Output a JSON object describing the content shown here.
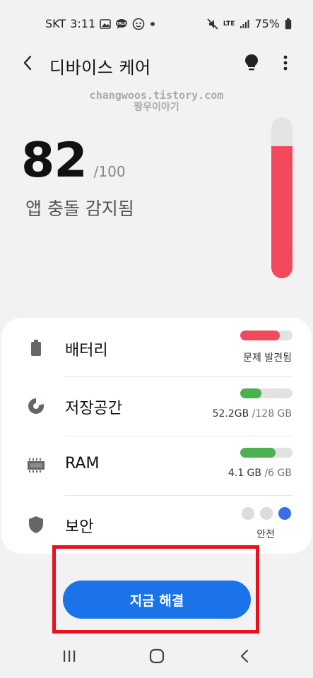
{
  "status_bar": {
    "carrier": "SKT",
    "time": "3:11",
    "network_top": "LTE",
    "battery": "75%",
    "icons": [
      "image-icon",
      "talk-icon",
      "chat-icon",
      "face-icon",
      "dot-icon"
    ],
    "right_icons": [
      "mute-icon",
      "lte-icon",
      "signal-icon",
      "battery-icon"
    ]
  },
  "header": {
    "title": "디바이스 케어",
    "icons": [
      "back-icon",
      "lightbulb-icon",
      "more-vert-icon"
    ]
  },
  "watermark": {
    "line1": "changwoos.tistory.com",
    "line2": "짱우이야기"
  },
  "score": {
    "value": "82",
    "max": "/100",
    "status": "앱 충돌 감지됨",
    "gauge_level": 0.82,
    "gauge_color": "#f24a5c"
  },
  "card": {
    "items": [
      {
        "label": "배터리",
        "icon": "battery-icon",
        "value": "문제 발견됨",
        "value_sub": "",
        "bar_level": 0.75,
        "bar_color": "#f24a5c"
      },
      {
        "label": "저장공간",
        "icon": "pie-chart-icon",
        "value": "52.2GB",
        "value_sub": "/128 GB",
        "bar_level": 0.41,
        "bar_color": "#4caf50"
      },
      {
        "label": "RAM",
        "icon": "memory-chip-icon",
        "value": "4.1 GB",
        "value_sub": "/6 GB",
        "bar_level": 0.68,
        "bar_color": "#4caf50"
      },
      {
        "label": "보안",
        "icon": "shield-icon",
        "value": "안전",
        "value_sub": "",
        "dots": [
          "#dcdcdc",
          "#dcdcdc",
          "#3a6ee8"
        ]
      }
    ]
  },
  "actions": {
    "fix_label": "지금 해결",
    "accent": "#1a73e8",
    "highlight_color": "#e8121e"
  },
  "navbar": {
    "icons": [
      "recents-icon",
      "home-icon",
      "back-nav-icon"
    ]
  }
}
